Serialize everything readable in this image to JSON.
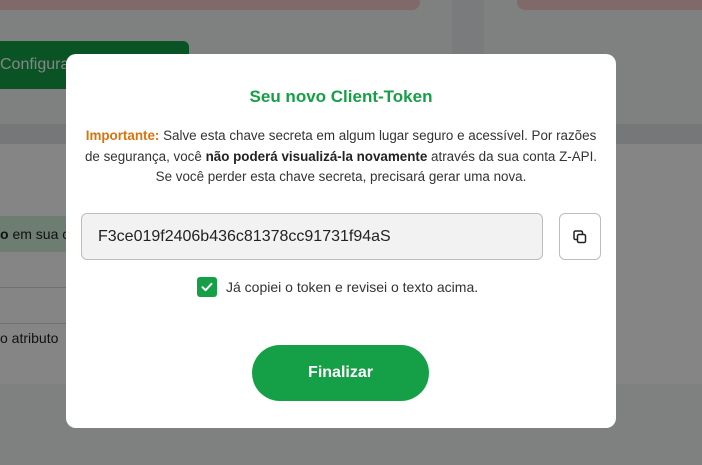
{
  "background": {
    "config_button_label": "Configura",
    "row_text_bold": "o",
    "row_text": " em sua c",
    "attr_text": "o atributo"
  },
  "modal": {
    "title": "Seu novo Client-Token",
    "important_label": "Importante:",
    "text_part1": " Salve esta chave secreta em algum lugar seguro e acessível. Por razões de segurança, você ",
    "text_bold": "não poderá visualizá-la novamente",
    "text_part2": " através da sua conta Z-API. Se você perder esta chave secreta, precisará gerar uma nova.",
    "token_value": "F3ce019f2406b436c81378cc91731f94aS",
    "copy_icon": "copy-icon",
    "checkbox_checked": true,
    "checkbox_label": "Já copiei o token e revisei o texto acima.",
    "finish_button_label": "Finalizar"
  },
  "colors": {
    "accent": "#159f46",
    "important": "#d9730d",
    "overlay": "rgba(0,0,0,0.48)"
  }
}
